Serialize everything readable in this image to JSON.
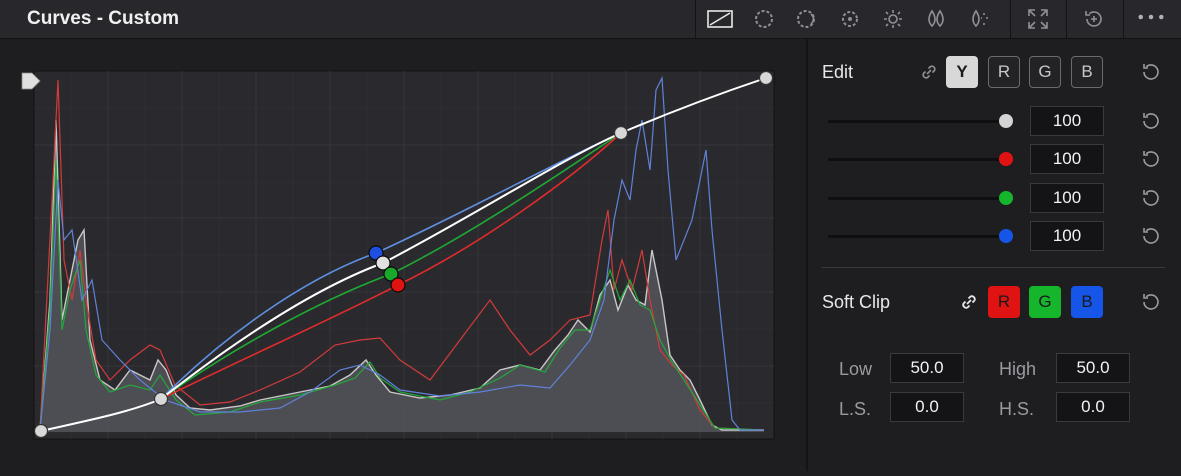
{
  "header": {
    "title": "Curves - Custom",
    "icons": [
      "custom-curve-icon",
      "hue-vs-hue-icon",
      "hue-vs-sat-icon",
      "hue-vs-lum-icon",
      "lum-vs-sat-icon",
      "sat-vs-sat-icon",
      "sat-vs-lum-icon",
      "expand-icon",
      "reset-all-icon",
      "more-icon"
    ]
  },
  "edit": {
    "label": "Edit",
    "channels": [
      "Y",
      "R",
      "G",
      "B"
    ],
    "selected_channel": "Y",
    "sliders": [
      {
        "channel": "Y",
        "value": "100",
        "color": "#d4d4d4"
      },
      {
        "channel": "R",
        "value": "100",
        "color": "#e01313"
      },
      {
        "channel": "G",
        "value": "100",
        "color": "#15b52c"
      },
      {
        "channel": "B",
        "value": "100",
        "color": "#1556e8"
      }
    ]
  },
  "soft_clip": {
    "label": "Soft Clip",
    "channels": [
      "R",
      "G",
      "B"
    ],
    "low_label": "Low",
    "low_value": "50.0",
    "high_label": "High",
    "high_value": "50.0",
    "ls_label": "L.S.",
    "ls_value": "0.0",
    "hs_label": "H.S.",
    "hs_value": "0.0"
  },
  "colors": {
    "luma": "#ffffff",
    "red": "#e22b2b",
    "green": "#1fa832",
    "blue": "#5f8fe0",
    "panel_bg": "#1e1e21",
    "graph_bg": "#2a2a2e"
  }
}
